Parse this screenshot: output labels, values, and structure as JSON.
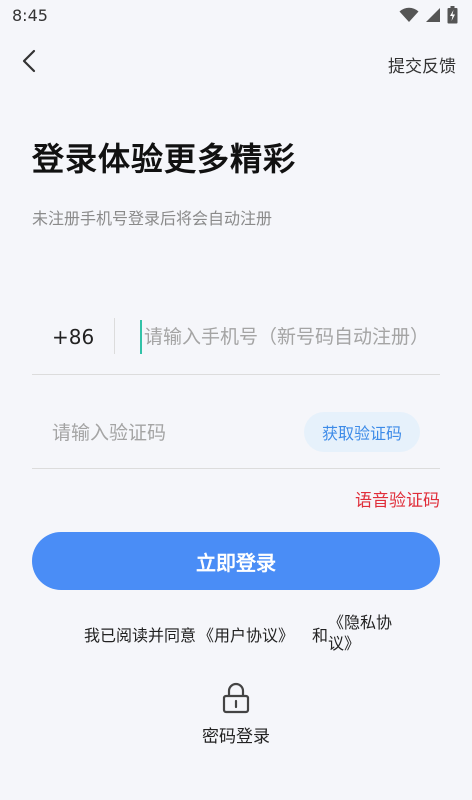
{
  "status_bar": {
    "time": "8:45",
    "icons": [
      "wifi-icon",
      "signal-icon",
      "battery-icon"
    ]
  },
  "nav": {
    "back_icon": "chevron-left-icon",
    "feedback_label": "提交反馈"
  },
  "header": {
    "title": "登录体验更多精彩",
    "subtitle": "未注册手机号登录后将会自动注册"
  },
  "phone": {
    "country_code": "+86",
    "placeholder": "请输入手机号（新号码自动注册）",
    "value": ""
  },
  "code": {
    "placeholder": "请输入验证码",
    "value": "",
    "get_code_label": "获取验证码"
  },
  "voice_code_label": "语音验证码",
  "login_button_label": "立即登录",
  "agreement": {
    "prefix": "我已阅读并同意",
    "user_agreement": "《用户协议》",
    "and": "和",
    "privacy_policy": "《隐私协议》"
  },
  "password_login": {
    "icon": "lock-icon",
    "label": "密码登录"
  },
  "colors": {
    "background": "#f5f6fa",
    "primary": "#4a8df6",
    "code_button_bg": "#e6f1fb",
    "code_button_text": "#3d8be8",
    "voice_code": "#e02e3a",
    "cursor": "#32c2a8"
  }
}
